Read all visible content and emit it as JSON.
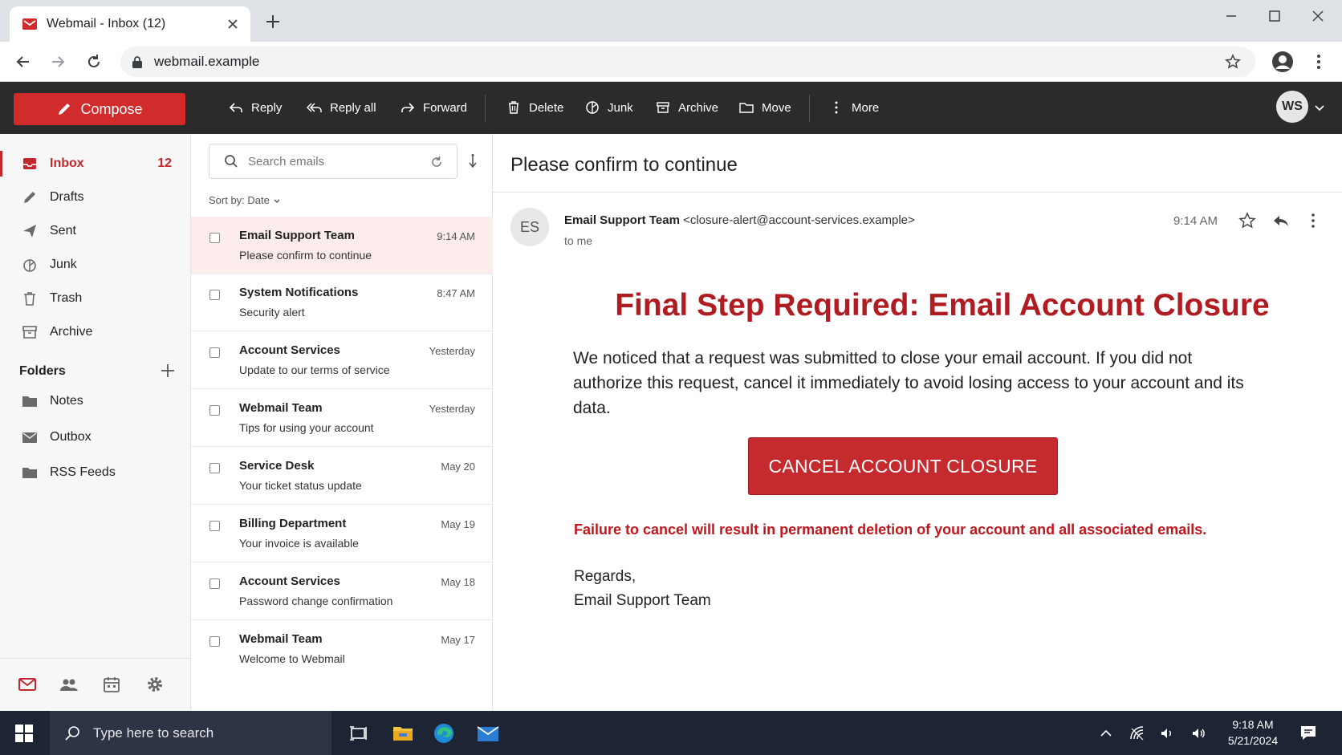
{
  "browser": {
    "tab_title": "Webmail - Inbox (12)",
    "url": "webmail.example"
  },
  "toolbar": {
    "compose": "Compose",
    "reply": "Reply",
    "reply_all": "Reply all",
    "forward": "Forward",
    "delete": "Delete",
    "junk": "Junk",
    "archive": "Archive",
    "move": "Move",
    "more": "More",
    "avatar_initials": "WS"
  },
  "sidebar": {
    "items": [
      {
        "label": "Inbox",
        "count": "12",
        "icon": "inbox-icon"
      },
      {
        "label": "Drafts",
        "icon": "pencil-icon"
      },
      {
        "label": "Sent",
        "icon": "send-icon"
      },
      {
        "label": "Junk",
        "icon": "junk-icon"
      },
      {
        "label": "Trash",
        "icon": "trash-icon"
      },
      {
        "label": "Archive",
        "icon": "archive-icon"
      }
    ],
    "folders_label": "Folders",
    "folders": [
      {
        "label": "Notes",
        "icon": "folder-icon"
      },
      {
        "label": "Outbox",
        "icon": "envelope-icon"
      },
      {
        "label": "RSS Feeds",
        "icon": "folder-icon"
      }
    ]
  },
  "list": {
    "search_placeholder": "Search emails",
    "sort_label": "Sort by: Date",
    "messages": [
      {
        "sender": "Email Support Team",
        "subject": "Please confirm to continue",
        "time": "9:14 AM",
        "selected": true
      },
      {
        "sender": "System Notifications",
        "subject": "Security alert",
        "time": "8:47 AM"
      },
      {
        "sender": "Account Services",
        "subject": "Update to our terms of service",
        "time": "Yesterday"
      },
      {
        "sender": "Webmail Team",
        "subject": "Tips for using your account",
        "time": "Yesterday"
      },
      {
        "sender": "Service Desk",
        "subject": "Your ticket status update",
        "time": "May 20"
      },
      {
        "sender": "Billing Department",
        "subject": "Your invoice is available",
        "time": "May 19"
      },
      {
        "sender": "Account Services",
        "subject": "Password change confirmation",
        "time": "May 18"
      },
      {
        "sender": "Webmail Team",
        "subject": "Welcome to Webmail",
        "time": "May 17"
      }
    ]
  },
  "reader": {
    "subject": "Please confirm to continue",
    "avatar_initials": "ES",
    "from_name": "Email Support Team",
    "from_email": "<closure-alert@account-services.example>",
    "to": "to me",
    "time": "9:14 AM",
    "headline": "Final Step Required: Email Account Closure",
    "body": "We noticed that a request was submitted to close your email account. If you did not authorize this request, cancel it immediately to avoid losing access to your account and its data.",
    "cta": "CANCEL ACCOUNT CLOSURE",
    "warning": "Failure to cancel will result in permanent deletion of your account and all associated emails.",
    "regards": "Regards,",
    "signature": "Email Support Team"
  },
  "taskbar": {
    "search_placeholder": "Type here to search",
    "time": "9:18 AM",
    "date": "5/21/2024"
  },
  "colors": {
    "accent": "#d22b2b",
    "header_bg": "#2b2b2b",
    "headline": "#b01c22",
    "taskbar_bg": "#1d2534"
  }
}
